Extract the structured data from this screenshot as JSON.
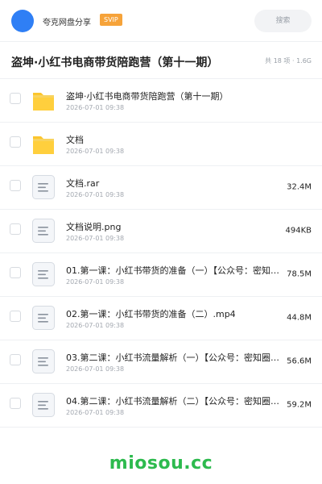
{
  "header": {
    "username": "夸克网盘分享",
    "badge": "SVIP",
    "search_placeholder": "搜索"
  },
  "folder": {
    "title": "盗坤·小红书电商带货陪跑营（第十一期）",
    "meta": "共 18 项 · 1.6G"
  },
  "files": [
    {
      "type": "folder",
      "icon": "folder-icon",
      "name": "盗坤·小红书电商带货陪跑营（第十一期）",
      "date": "2026-07-01 09:38",
      "size": ""
    },
    {
      "type": "folder",
      "icon": "folder-icon",
      "name": "文档",
      "date": "2026-07-01 09:38",
      "size": ""
    },
    {
      "type": "file",
      "icon": "file-icon",
      "name": "文档.rar",
      "date": "2026-07-01 09:38",
      "size": "32.4M"
    },
    {
      "type": "file",
      "icon": "file-icon",
      "name": "文档说明.png",
      "date": "2026-07-01 09:38",
      "size": "494KB"
    },
    {
      "type": "file",
      "icon": "file-icon",
      "name": "01.第一课：小红书带货的准备（一）【公众号：密知…",
      "date": "2026-07-01 09:38",
      "size": "78.5M"
    },
    {
      "type": "file",
      "icon": "file-icon",
      "name": "02.第一课：小红书带货的准备（二）.mp4",
      "date": "2026-07-01 09:38",
      "size": "44.8M"
    },
    {
      "type": "file",
      "icon": "file-icon",
      "name": "03.第二课：小红书流量解析（一）【公众号：密知圈…",
      "date": "2026-07-01 09:38",
      "size": "56.6M"
    },
    {
      "type": "file",
      "icon": "file-icon",
      "name": "04.第二课：小红书流量解析（二）【公众号：密知圈…",
      "date": "2026-07-01 09:38",
      "size": "59.2M"
    }
  ],
  "watermark": "miosou.cc",
  "colors": {
    "avatar": "#2f7ff5",
    "badge": "#f6a33a",
    "folder": "#fcc52d",
    "watermark": "#2dba4e"
  }
}
